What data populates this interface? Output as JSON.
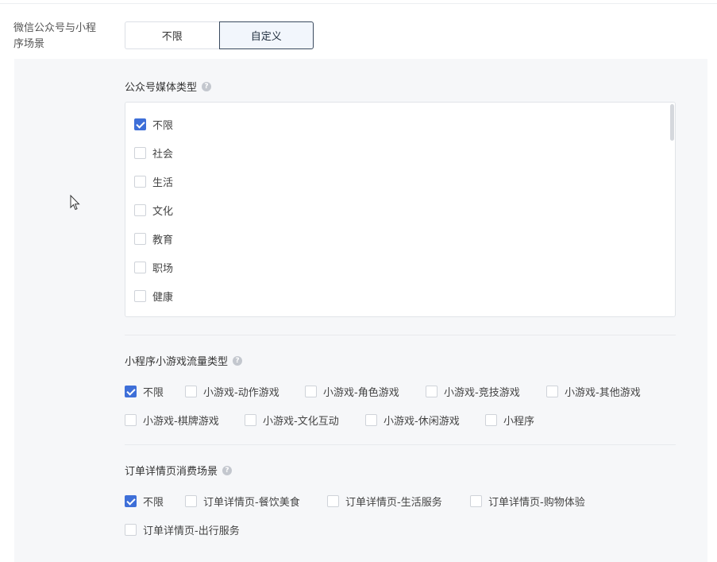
{
  "field": {
    "label": "微信公众号与小程序场景"
  },
  "segmented": {
    "options": [
      "不限",
      "自定义"
    ],
    "active": "自定义"
  },
  "media_type": {
    "title": "公众号媒体类型",
    "items": [
      {
        "label": "不限",
        "checked": true
      },
      {
        "label": "社会",
        "checked": false
      },
      {
        "label": "生活",
        "checked": false
      },
      {
        "label": "文化",
        "checked": false
      },
      {
        "label": "教育",
        "checked": false
      },
      {
        "label": "职场",
        "checked": false
      },
      {
        "label": "健康",
        "checked": false
      }
    ]
  },
  "mini_traffic": {
    "title": "小程序小游戏流量类型",
    "items": [
      {
        "label": "不限",
        "checked": true
      },
      {
        "label": "小游戏-动作游戏",
        "checked": false
      },
      {
        "label": "小游戏-角色游戏",
        "checked": false
      },
      {
        "label": "小游戏-竞技游戏",
        "checked": false
      },
      {
        "label": "小游戏-其他游戏",
        "checked": false
      },
      {
        "label": "小游戏-棋牌游戏",
        "checked": false
      },
      {
        "label": "小游戏-文化互动",
        "checked": false
      },
      {
        "label": "小游戏-休闲游戏",
        "checked": false
      },
      {
        "label": "小程序",
        "checked": false
      }
    ]
  },
  "order_scene": {
    "title": "订单详情页消费场景",
    "items": [
      {
        "label": "不限",
        "checked": true
      },
      {
        "label": "订单详情页-餐饮美食",
        "checked": false
      },
      {
        "label": "订单详情页-生活服务",
        "checked": false
      },
      {
        "label": "订单详情页-购物体验",
        "checked": false
      },
      {
        "label": "订单详情页-出行服务",
        "checked": false
      }
    ]
  },
  "colors": {
    "accent": "#3e6fd8",
    "panel_bg": "#f6f7f9",
    "active_border": "#3a4a5e"
  }
}
